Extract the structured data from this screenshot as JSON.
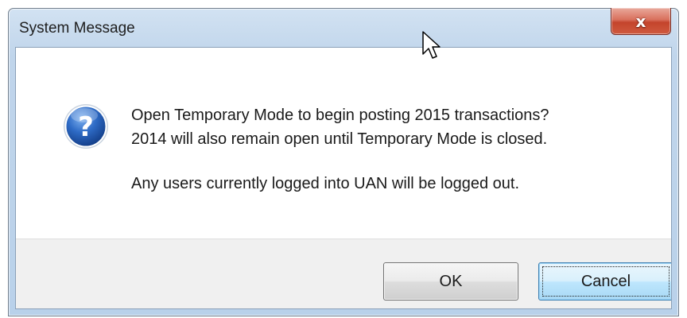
{
  "window": {
    "title": "System Message",
    "close_label": "x"
  },
  "message": {
    "icon": "question-icon",
    "lines": [
      "Open Temporary Mode to begin posting 2015 transactions?",
      "2014 will also remain open until Temporary Mode is closed.",
      "Any users currently logged into UAN will be logged out."
    ]
  },
  "buttons": {
    "ok_label": "OK",
    "cancel_label": "Cancel",
    "focused": "Cancel"
  },
  "colors": {
    "accent": "#3c7fb1",
    "close_button": "#c4442c",
    "icon_blue": "#1c4fa8"
  }
}
